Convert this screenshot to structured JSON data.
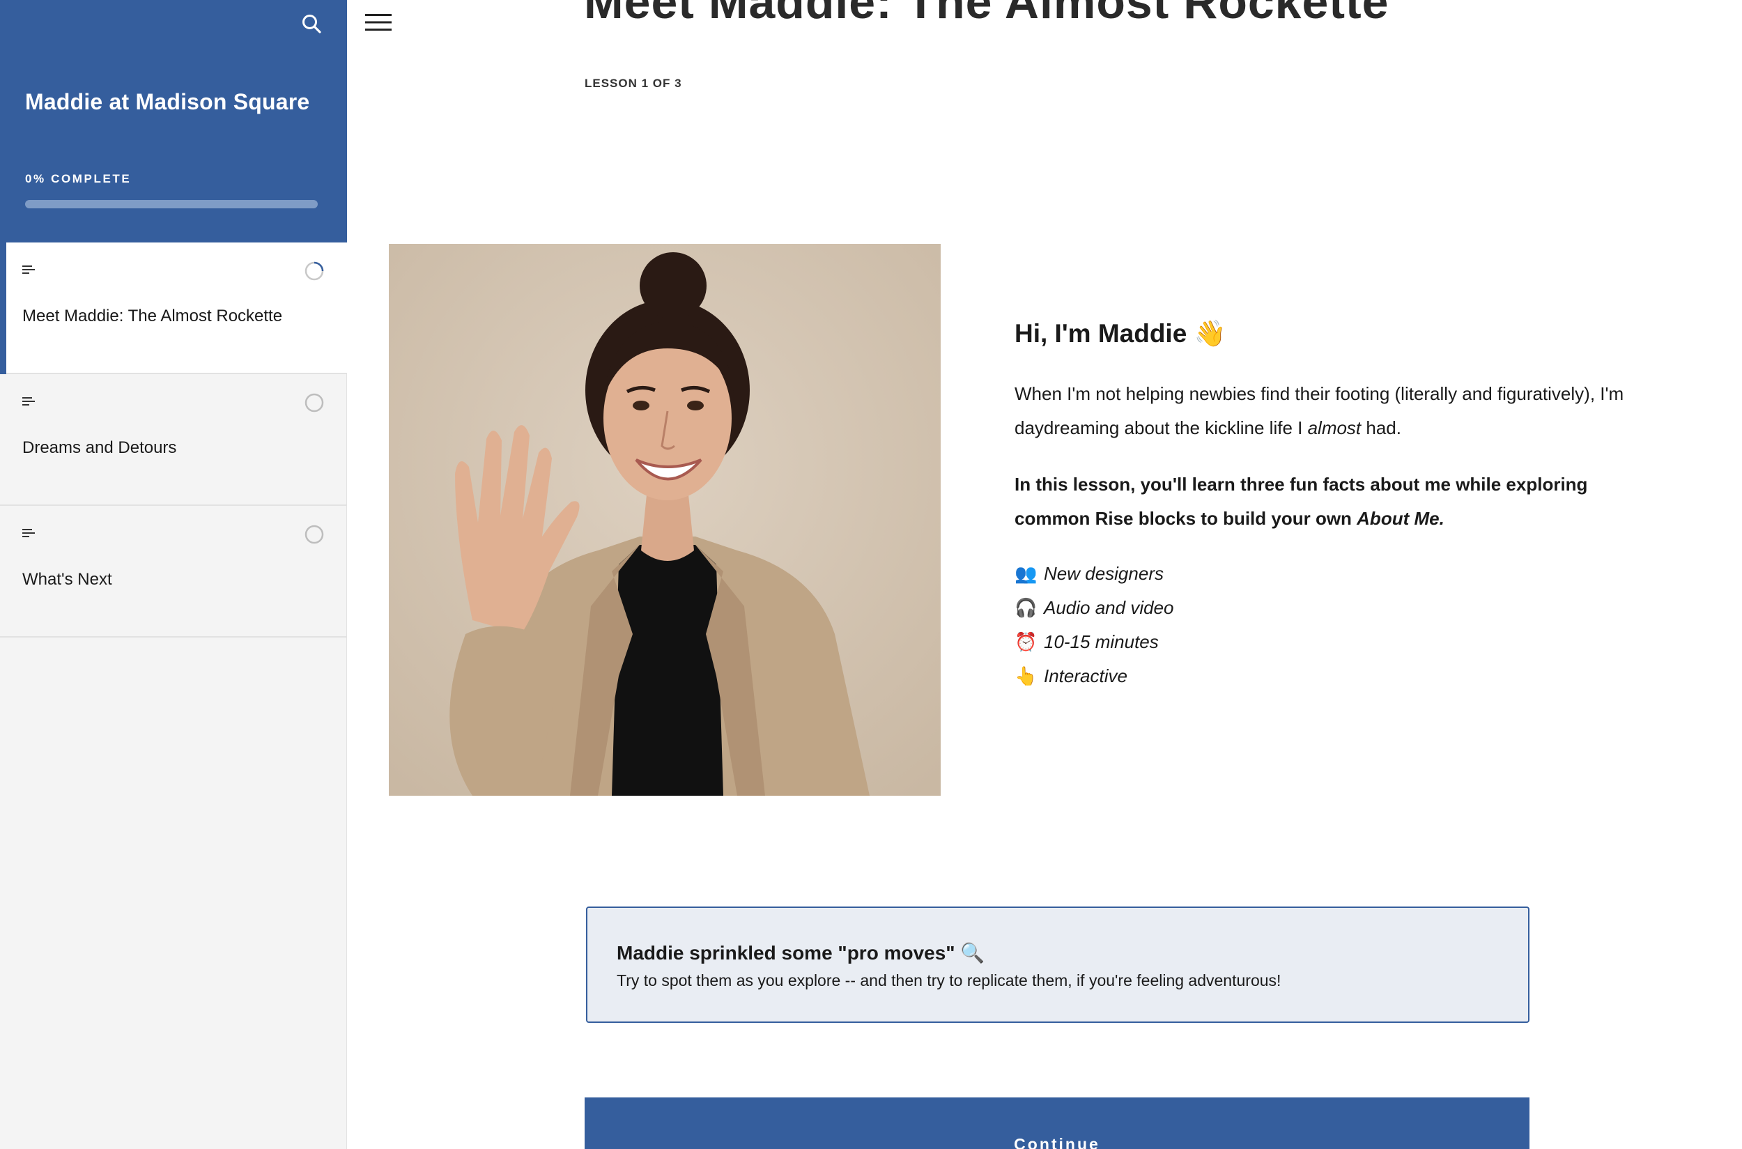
{
  "sidebar": {
    "course_title": "Maddie at Madison Square",
    "progress_label": "0% COMPLETE",
    "progress_fraction": 0,
    "search_icon": "search-icon",
    "lessons": [
      {
        "title": "Meet Maddie: The Almost Rockette",
        "status": "in-progress",
        "active": true
      },
      {
        "title": "Dreams and Detours",
        "status": "not-started",
        "active": false
      },
      {
        "title": "What's Next",
        "status": "not-started",
        "active": false
      }
    ]
  },
  "header": {
    "menu_icon": "hamburger-menu-icon",
    "title": "Meet Maddie: The Almost Rockette",
    "counter": "LESSON 1 OF 3"
  },
  "intro": {
    "heading": "Hi, I'm Maddie 👋",
    "p1_before": "When I'm not helping newbies find their footing (literally and figuratively), I'm daydreaming about the kickline life I ",
    "p1_em": "almost",
    "p1_after": " had.",
    "p2_before": "In this lesson, you'll learn three fun facts about me while exploring common Rise blocks to build your own ",
    "p2_em": "About Me.",
    "facts": [
      {
        "emoji": "👥",
        "text": "New designers"
      },
      {
        "emoji": "🎧",
        "text": "Audio and video"
      },
      {
        "emoji": "⏰",
        "text": "10-15 minutes"
      },
      {
        "emoji": "👆",
        "text": "Interactive"
      }
    ]
  },
  "callout": {
    "title": "Maddie sprinkled some \"pro moves\" 🔍",
    "text": "Try to spot them as you explore -- and then try to replicate them, if you're feeling adventurous!"
  },
  "continue_label": "Continue",
  "colors": {
    "brand": "#355e9d",
    "sidebar_bg": "#f4f4f4",
    "callout_bg": "#e9edf3"
  }
}
